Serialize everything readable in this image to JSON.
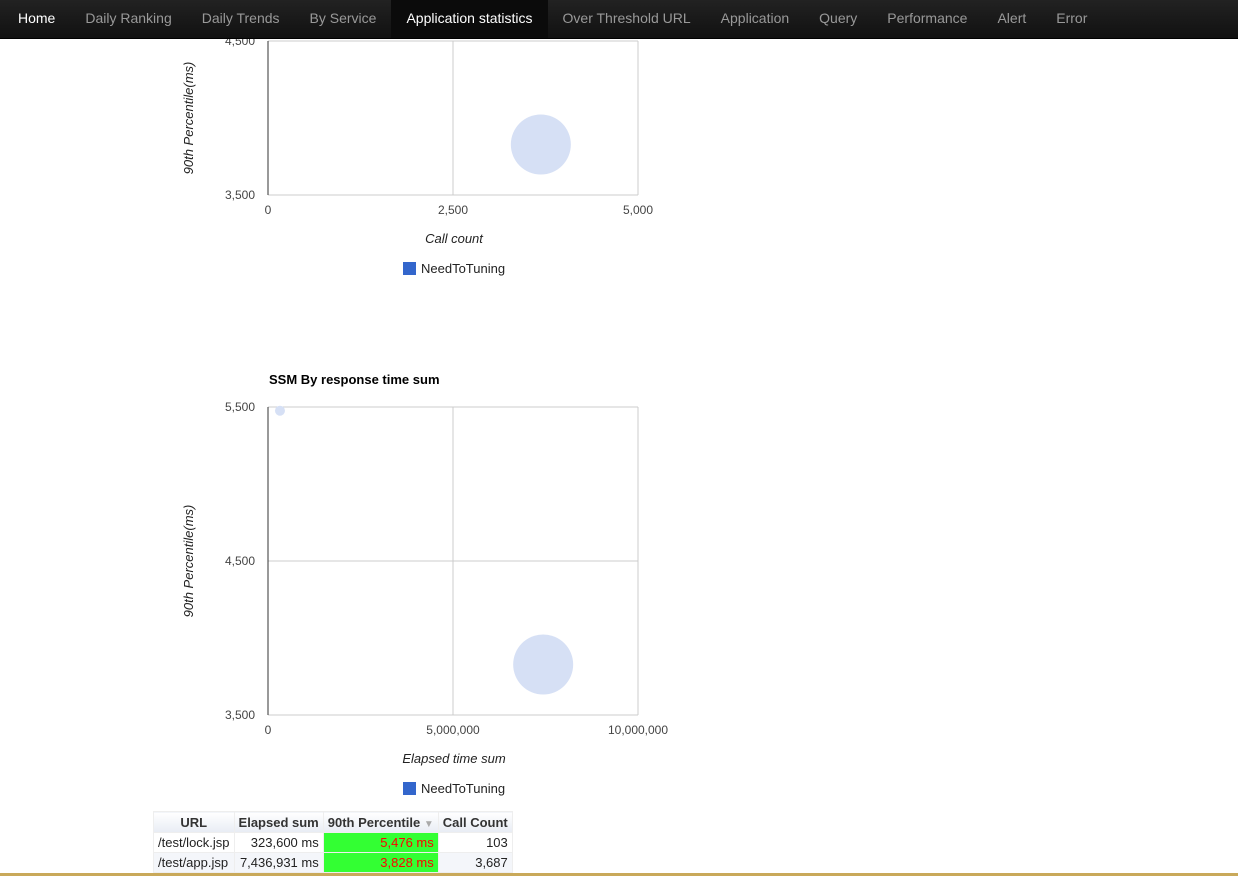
{
  "nav": {
    "items": [
      {
        "label": "Home",
        "state": "home"
      },
      {
        "label": "Daily Ranking",
        "state": ""
      },
      {
        "label": "Daily Trends",
        "state": ""
      },
      {
        "label": "By Service",
        "state": ""
      },
      {
        "label": "Application statistics",
        "state": "active"
      },
      {
        "label": "Over Threshold URL",
        "state": ""
      },
      {
        "label": "Application",
        "state": ""
      },
      {
        "label": "Query",
        "state": ""
      },
      {
        "label": "Performance",
        "state": ""
      },
      {
        "label": "Alert",
        "state": ""
      },
      {
        "label": "Error",
        "state": ""
      }
    ]
  },
  "colors": {
    "bubble": "#d6e0f5",
    "legend_swatch": "#3366cc",
    "highlight_bg": "#33ff33",
    "highlight_text": "#ff0000"
  },
  "chart_data": [
    {
      "type": "scatter",
      "subtype": "bubble",
      "title": "",
      "xlabel": "Call count",
      "ylabel": "90th Percentile(ms)",
      "xlim": [
        0,
        5000
      ],
      "ylim": [
        3500,
        4500
      ],
      "x_ticks": [
        "0",
        "2,500",
        "5,000"
      ],
      "y_ticks": [
        "3,500",
        "4,500"
      ],
      "legend": {
        "position": "bottom",
        "entries": [
          "NeedToTuning"
        ]
      },
      "grid": true,
      "series": [
        {
          "name": "NeedToTuning",
          "points": [
            {
              "label": "/test/app.jsp",
              "x": 3687,
              "y": 3828,
              "size": 7436931
            }
          ]
        }
      ]
    },
    {
      "type": "scatter",
      "subtype": "bubble",
      "title": "SSM By response time sum",
      "xlabel": "Elapsed time sum",
      "ylabel": "90th Percentile(ms)",
      "xlim": [
        0,
        10000000
      ],
      "ylim": [
        3500,
        5500
      ],
      "x_ticks": [
        "0",
        "5,000,000",
        "10,000,000"
      ],
      "y_ticks": [
        "3,500",
        "4,500",
        "5,500"
      ],
      "legend": {
        "position": "bottom",
        "entries": [
          "NeedToTuning"
        ]
      },
      "grid": true,
      "series": [
        {
          "name": "NeedToTuning",
          "points": [
            {
              "label": "/test/lock.jsp",
              "x": 323600,
              "y": 5476,
              "size": 103
            },
            {
              "label": "/test/app.jsp",
              "x": 7436931,
              "y": 3828,
              "size": 3687
            }
          ]
        }
      ]
    }
  ],
  "table": {
    "headers": [
      "URL",
      "Elapsed sum",
      "90th Percentile",
      "Call Count"
    ],
    "sort_indicator": "▼",
    "rows": [
      [
        "/test/lock.jsp",
        "323,600 ms",
        "5,476 ms",
        "103"
      ],
      [
        "/test/app.jsp",
        "7,436,931 ms",
        "3,828 ms",
        "3,687"
      ]
    ]
  }
}
